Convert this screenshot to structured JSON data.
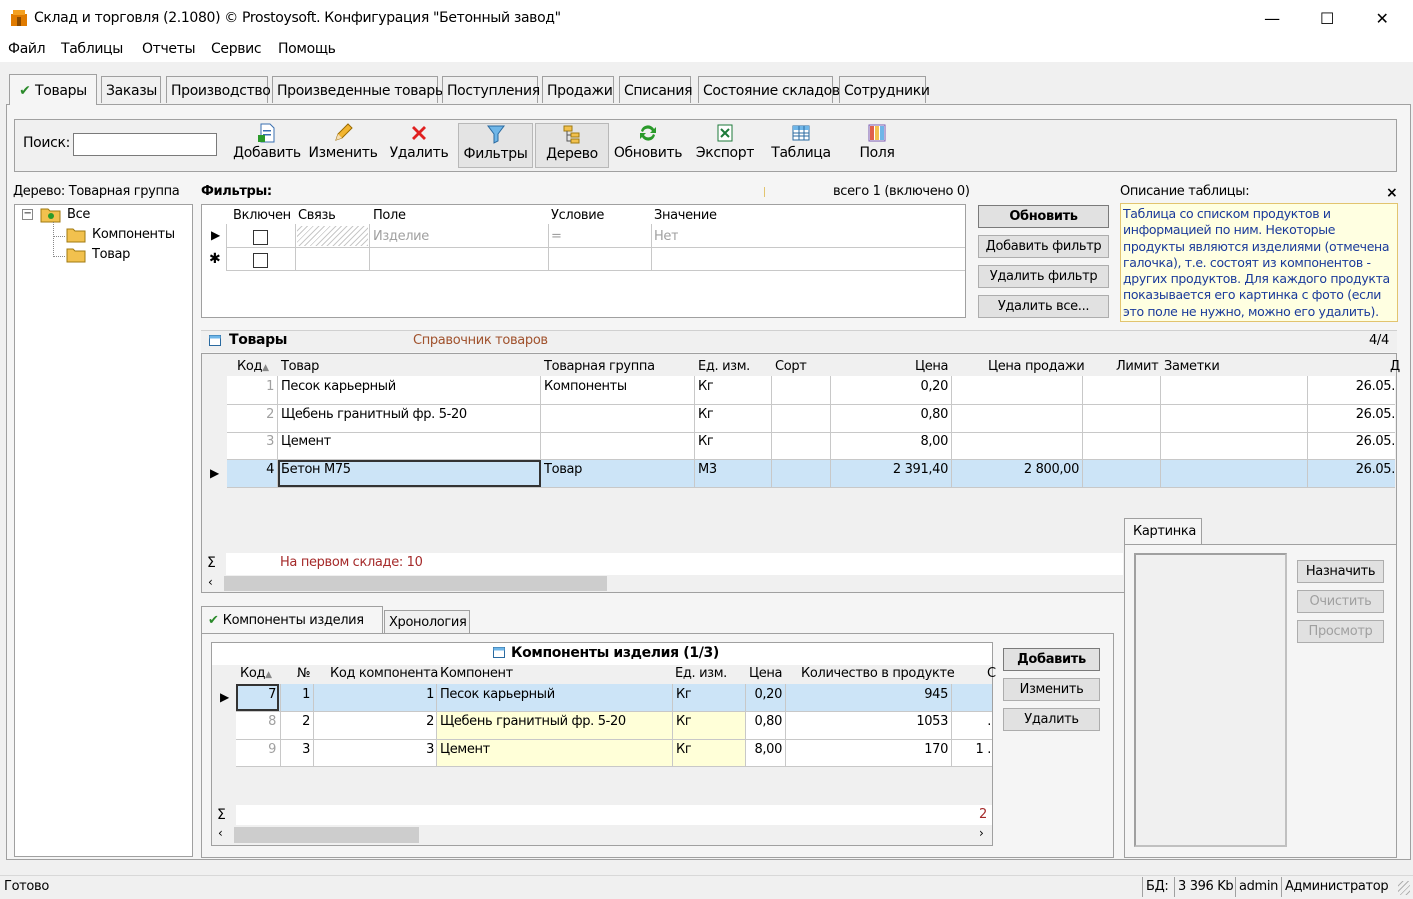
{
  "window": {
    "title": "Склад и торговля (2.1080) © Prostoysoft. Конфигурация \"Бетонный завод\"",
    "minimize": "—",
    "maximize": "☐",
    "close": "✕"
  },
  "menu": [
    "Файл",
    "Таблицы",
    "Отчеты",
    "Сервис",
    "Помощь"
  ],
  "tabs": [
    "Товары",
    "Заказы",
    "Производство",
    "Произведенные товары",
    "Поступления",
    "Продажи",
    "Списания",
    "Состояние складов",
    "Сотрудники"
  ],
  "toolbar": {
    "search_label": "Поиск:",
    "search_value": "",
    "buttons": [
      "Добавить",
      "Изменить",
      "Удалить",
      "Фильтры",
      "Дерево",
      "Обновить",
      "Экспорт",
      "Таблица",
      "Поля"
    ]
  },
  "tree": {
    "title": "Дерево: Товарная группа",
    "root": "Все",
    "children": [
      "Компоненты",
      "Товар"
    ],
    "expander": "−"
  },
  "filters": {
    "title": "Фильтры:",
    "total": "всего 1 (включено 0)",
    "headers": [
      "Включен",
      "Связь",
      "Поле",
      "Условие",
      "Значение"
    ],
    "row": {
      "field": "Изделие",
      "condition": "=",
      "value": "Нет"
    },
    "buttons": [
      "Обновить",
      "Добавить фильтр",
      "Удалить фильтр",
      "Удалить все..."
    ]
  },
  "description": {
    "title": "Описание таблицы:",
    "close": "×",
    "text": "Таблица со списком продуктов и информацией по ним. Некоторые продукты являются изделиями (отмечена галочка), т.е. состоят из компонентов - других продуктов. Для  каждого продукта показывается его картинка с фото (если это поле не нужно, можно его удалить)."
  },
  "products": {
    "title": "Товары",
    "subtitle": "Справочник товаров",
    "count": "4/4",
    "headers": [
      "Код",
      "Товар",
      "Товарная группа",
      "Ед. изм.",
      "Сорт",
      "Цена",
      "Цена продажи",
      "Лимит",
      "Заметки",
      "Д"
    ],
    "rows": [
      {
        "code": "1",
        "name": "Песок карьерный",
        "group": "Компоненты",
        "unit": "Кг",
        "sort": "",
        "price": "0,20",
        "sale": "",
        "limit": "",
        "notes": "",
        "date": "26.05."
      },
      {
        "code": "2",
        "name": "Щебень гранитный фр. 5-20",
        "group": "",
        "unit": "Кг",
        "sort": "",
        "price": "0,80",
        "sale": "",
        "limit": "",
        "notes": "",
        "date": "26.05."
      },
      {
        "code": "3",
        "name": "Цемент",
        "group": "",
        "unit": "Кг",
        "sort": "",
        "price": "8,00",
        "sale": "",
        "limit": "",
        "notes": "",
        "date": "26.05."
      },
      {
        "code": "4",
        "name": "Бетон М75",
        "group": "Товар",
        "unit": "М3",
        "sort": "",
        "price": "2 391,40",
        "sale": "2 800,00",
        "limit": "",
        "notes": "",
        "date": "26.05."
      }
    ],
    "summary": "На первом складе: 10",
    "sigma": "Σ"
  },
  "picture": {
    "tab": "Картинка",
    "buttons": [
      "Назначить",
      "Очистить",
      "Просмотр"
    ]
  },
  "subtabs": [
    "Компоненты изделия",
    "Хронология"
  ],
  "components": {
    "title": "Компоненты изделия (1/3)",
    "headers": [
      "Код",
      "№",
      "Код компонента",
      "Компонент",
      "Ед. изм.",
      "Цена",
      "Количество в продукте",
      "С"
    ],
    "rows": [
      {
        "code": "7",
        "num": "1",
        "comp_code": "1",
        "comp": "Песок карьерный",
        "unit": "Кг",
        "price": "0,20",
        "qty": "945",
        "extra": ""
      },
      {
        "code": "8",
        "num": "2",
        "comp_code": "2",
        "comp": "Щебень гранитный фр. 5-20",
        "unit": "Кг",
        "price": "0,80",
        "qty": "1053",
        "extra": "."
      },
      {
        "code": "9",
        "num": "3",
        "comp_code": "3",
        "comp": "Цемент",
        "unit": "Кг",
        "price": "8,00",
        "qty": "170",
        "extra": "1 ."
      }
    ],
    "sum_right": "2",
    "sigma": "Σ",
    "buttons": [
      "Добавить",
      "Изменить",
      "Удалить"
    ]
  },
  "status": {
    "left": "Готово",
    "db": "БД:",
    "size": "3 396 Kb",
    "user": "admin",
    "role": "Администратор"
  },
  "colors": {
    "selected_row": "#cce4f7",
    "yellow_cell": "#ffffd8",
    "desc_bg": "#ffffe1",
    "desc_border": "#e2c46f",
    "summary_text": "#a52a2a",
    "subtitle_text": "#a0522d"
  }
}
